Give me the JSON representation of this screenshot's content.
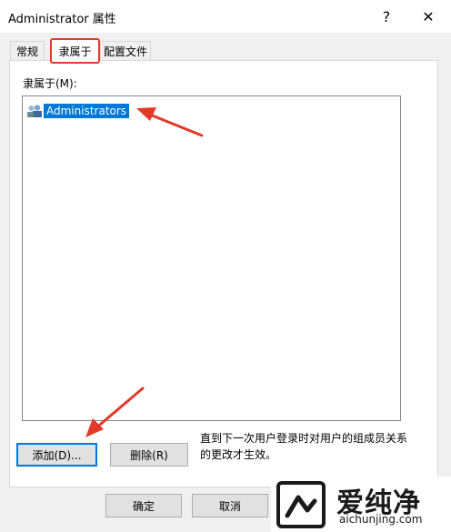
{
  "window": {
    "title": "Administrator 属性",
    "help_glyph": "?",
    "close_glyph": "✕"
  },
  "tabs": [
    {
      "label": "常规",
      "active": false
    },
    {
      "label": "隶属于",
      "active": true
    },
    {
      "label": "配置文件",
      "active": false
    }
  ],
  "memberof": {
    "label": "隶属于(M):",
    "items": [
      {
        "label": "Administrators",
        "icon": "group-icon",
        "selected": true
      }
    ]
  },
  "buttons": {
    "add": "添加(D)...",
    "remove": "删除(R)",
    "ok": "确定",
    "cancel": "取消"
  },
  "note": "直到下一次用户登录时对用户的组成员关系的更改才生效。",
  "watermark": {
    "chinese": "爱纯净",
    "site": "aichunjing.com"
  },
  "colors": {
    "selection": "#0078d7",
    "annotation": "#e23a2a"
  }
}
